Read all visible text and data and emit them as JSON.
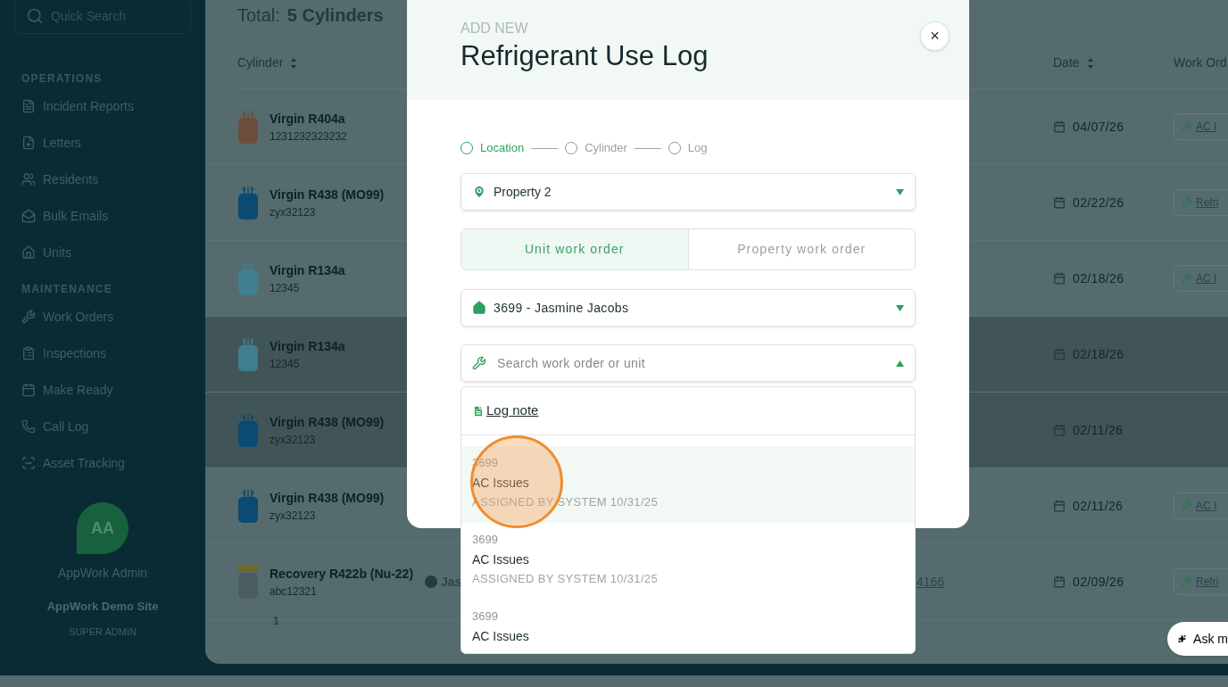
{
  "sidebar": {
    "search": {
      "placeholder": "Quick Search"
    },
    "sections": [
      {
        "title": "OPERATIONS",
        "items": [
          {
            "label": "Incident Reports"
          },
          {
            "label": "Letters"
          },
          {
            "label": "Residents"
          },
          {
            "label": "Bulk Emails"
          },
          {
            "label": "Units"
          }
        ]
      },
      {
        "title": "MAINTENANCE",
        "items": [
          {
            "label": "Work Orders"
          },
          {
            "label": "Inspections"
          },
          {
            "label": "Make Ready"
          },
          {
            "label": "Call Log"
          },
          {
            "label": "Asset Tracking"
          }
        ]
      }
    ],
    "user": {
      "initials": "AA",
      "name": "AppWork Admin",
      "site": "AppWork Demo Site",
      "role": "SUPER ADMIN"
    }
  },
  "main": {
    "total_label": "Total:",
    "total_value": "5 Cylinders",
    "columns": [
      "Cylinder",
      "Date",
      "Work Ord"
    ],
    "rows": [
      {
        "kind": "virgin",
        "color": "#6b4f3c",
        "name": "Virgin R404a",
        "code": "1231232323232",
        "date": "04/07/26",
        "work_order": "AC I",
        "highlighted": false
      },
      {
        "kind": "virgin",
        "color": "#0b4a72",
        "name": "Virgin R438 (MO99)",
        "code": "zyx32123",
        "date": "02/22/26",
        "work_order": "Refri",
        "highlighted": false
      },
      {
        "kind": "virgin",
        "color": "#3f7f8f",
        "name": "Virgin R134a",
        "code": "12345",
        "date": "02/18/26",
        "work_order": "AC I",
        "highlighted": false
      },
      {
        "kind": "virgin",
        "color": "#3f7f8f",
        "name": "Virgin R134a",
        "code": "12345",
        "date": "02/18/26",
        "highlighted": true
      },
      {
        "kind": "virgin",
        "color": "#0b4a72",
        "name": "Virgin R438 (MO99)",
        "code": "zyx32123",
        "date": "02/11/26",
        "highlighted": true
      },
      {
        "kind": "virgin",
        "color": "#0b4a72",
        "name": "Virgin R438 (MO99)",
        "code": "zyx32123",
        "date": "02/11/26",
        "work_order": "AC I",
        "highlighted": false
      },
      {
        "kind": "recovery",
        "color": "#4a5e61",
        "name": "Recovery R422b (Nu-22)",
        "code": "abc12321",
        "assignee": "Jas",
        "link": "4166",
        "date": "02/09/26",
        "work_order": "Refri",
        "highlighted": false
      }
    ],
    "pagination": [
      "1"
    ]
  },
  "modal": {
    "eyebrow": "ADD NEW",
    "title": "Refrigerant Use Log",
    "close": "×",
    "steps": [
      {
        "label": "Location",
        "selected": true
      },
      {
        "label": "Cylinder",
        "selected": false
      },
      {
        "label": "Log",
        "selected": false
      }
    ],
    "property": {
      "value": "Property 2"
    },
    "toggle": [
      {
        "label": "Unit work order",
        "selected": true
      },
      {
        "label": "Property work order",
        "selected": false
      }
    ],
    "unit": {
      "value": "3699 - Jasmine Jacobs"
    },
    "work_order_search": {
      "placeholder": "Search work order or unit",
      "expanded": true
    },
    "dropdown": {
      "log_note": "Log note",
      "options": [
        {
          "number": "3699",
          "title": "AC Issues",
          "assigned": "ASSIGNED BY SYSTEM 10/31/25",
          "highlighted": true
        },
        {
          "number": "3699",
          "title": "AC Issues",
          "assigned": "ASSIGNED BY SYSTEM 10/31/25",
          "highlighted": false
        },
        {
          "number": "3699",
          "title": "AC Issues",
          "highlighted": false
        }
      ]
    }
  },
  "assistant": {
    "label": "Ask m"
  }
}
